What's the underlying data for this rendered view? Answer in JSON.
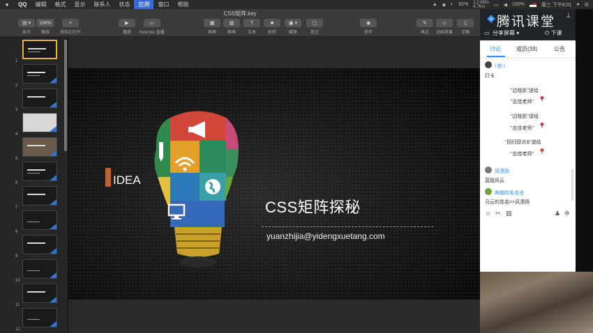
{
  "menubar": {
    "items": [
      "QQ",
      "编辑",
      "格式",
      "显示",
      "联系人",
      "状态",
      "应用",
      "窗口",
      "帮助"
    ],
    "active_index": 6,
    "battery": "82%",
    "net_up": "1.2 KB/s",
    "net_down": "6.7K/s",
    "battery2": "100%",
    "clock": "周三 下午8:01"
  },
  "document": {
    "title": "CSS矩阵.key"
  },
  "toolbar": {
    "display_label": "显示",
    "zoom_value": "108%",
    "zoom_label": "缩放",
    "add_slide_label": "添加幻灯片",
    "play_label": "播放",
    "keynote_live_label": "Keynote 直播",
    "table_label": "表格",
    "chart_label": "图表",
    "text_label": "文本",
    "shape_label": "形状",
    "media_label": "媒体",
    "comment_label": "批注",
    "collab_label": "协作",
    "format_label": "格式",
    "animate_label": "动画效果",
    "document_label": "文稿"
  },
  "navigator": {
    "slides": [
      "1",
      "2",
      "3",
      "4",
      "5",
      "6",
      "7",
      "8",
      "9",
      "10",
      "11",
      "12"
    ],
    "selected": 0
  },
  "slide": {
    "idea": "IDEA",
    "title": "CSS矩阵探秘",
    "email": "yuanzhijia@yidengxuetang.com"
  },
  "classroom": {
    "logo": "腾讯课堂",
    "share": "分享屏幕",
    "leave": "下课",
    "tabs": [
      "讨论",
      "成员(39)",
      "公告"
    ],
    "messages": [
      {
        "user": "I 默 I",
        "text": "打卡"
      },
      {
        "user": "风潇扬",
        "text": "蓝鼓风云"
      },
      {
        "user": "奔跑的毛毛虫",
        "text": "马云的花名=>风潇扬"
      }
    ],
    "gifts": [
      {
        "from": "\"边晓凯\"送给",
        "to": "\"志佳老师\""
      },
      {
        "from": "\"边晓凯\"送给",
        "to": "\"志佳老师\""
      },
      {
        "from": "\"回归原点&\"送给",
        "to": "\"志佳老师\""
      }
    ]
  },
  "colors": {
    "accent": "#2a8cff",
    "keynote_selection": "#e6b53a",
    "slide_bg": "#121212"
  }
}
